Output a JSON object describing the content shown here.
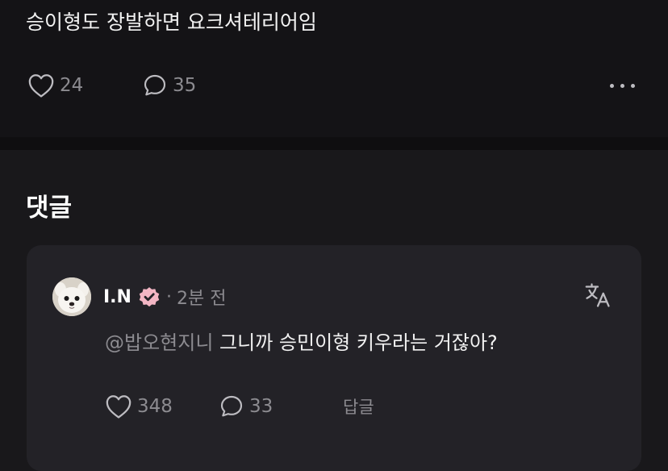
{
  "post": {
    "text": "승이형도 장발하면 요크셔테리어임",
    "like_count": "24",
    "comment_count": "35",
    "icons": {
      "like": "heart-outline-icon",
      "comment": "speech-bubble-icon",
      "more": "more-dots-icon"
    }
  },
  "comments_section": {
    "title": "댓글"
  },
  "comment": {
    "author": "I.N",
    "separator": "·",
    "time": "2분 전",
    "mention": "@밥오현지니",
    "text": "그니까 승민이형 키우라는 거잖아?",
    "like_count": "348",
    "reply_count": "33",
    "reply_label": "답글",
    "icons": {
      "avatar": "puppy-avatar",
      "verified": "verified-badge-icon",
      "translate": "translate-icon"
    }
  },
  "colors": {
    "background": "#19181b",
    "post_background": "#141316",
    "card_background": "#232227",
    "muted_text": "#8c8b90",
    "verified_badge": "#f3b6c4"
  }
}
